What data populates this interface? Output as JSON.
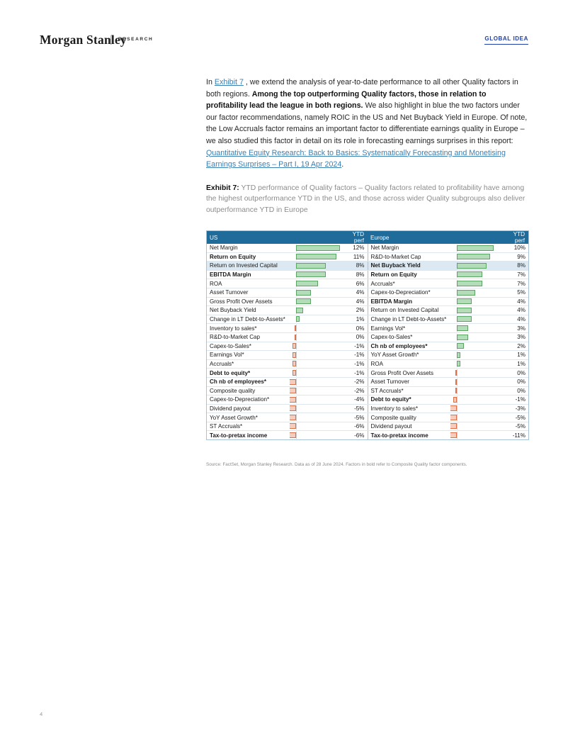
{
  "header": {
    "logo": "Morgan Stanley",
    "separator": "|",
    "research_label": "RESEARCH",
    "global_idea": "GLOBAL IDEA"
  },
  "body": {
    "para1_a": "In ",
    "para1_link1": "Exhibit 7",
    "para1_b": " , we extend the analysis of year-to-date performance to all other Quality factors in both regions. ",
    "para1_bold": "Among the top outperforming Quality factors, those in relation to profitability lead the league in both regions.",
    "para1_c": " We also highlight in blue the two factors under our factor recommendations, namely ROIC in the US and Net Buyback Yield in Europe. Of note, the Low Accruals factor remains an important factor to differentiate earnings quality in Europe – we also studied this factor in detail on its role in forecasting earnings surprises in this report: ",
    "para1_link2": "Quantitative Equity Research: Back to Basics: Systematically Forecasting and Monetising Earnings Surprises – Part I, 19 Apr 2024",
    "para1_d": "."
  },
  "exhibit": {
    "label": "Exhibit 7:",
    "caption": " YTD performance of Quality factors – Quality factors related to profitability have among the highest outperformance YTD in the US, and those across wider Quality subgroups also deliver outperformance YTD in Europe",
    "source": "Source: FactSet, Morgan Stanley Research. Data as of 28 June 2024. Factors in bold refer to Composite Quality factor components."
  },
  "table": {
    "headers": {
      "us": "US",
      "us_perf": "YTD perf",
      "europe": "Europe",
      "europe_perf": "YTD perf"
    },
    "us_rows": [
      {
        "name": "Net Margin",
        "value": "12%",
        "num": 12,
        "bold": false,
        "highlight": false
      },
      {
        "name": "Return on Equity",
        "value": "11%",
        "num": 11,
        "bold": true,
        "highlight": false
      },
      {
        "name": "Return on Invested Capital",
        "value": "8%",
        "num": 8,
        "bold": false,
        "highlight": true
      },
      {
        "name": "EBITDA Margin",
        "value": "8%",
        "num": 8,
        "bold": true,
        "highlight": false
      },
      {
        "name": "ROA",
        "value": "6%",
        "num": 6,
        "bold": false,
        "highlight": false
      },
      {
        "name": "Asset Turnover",
        "value": "4%",
        "num": 4,
        "bold": false,
        "highlight": false
      },
      {
        "name": "Gross Profit Over Assets",
        "value": "4%",
        "num": 4,
        "bold": false,
        "highlight": false
      },
      {
        "name": "Net Buyback Yield",
        "value": "2%",
        "num": 2,
        "bold": false,
        "highlight": false
      },
      {
        "name": "Change in LT Debt-to-Assets*",
        "value": "1%",
        "num": 1,
        "bold": false,
        "highlight": false
      },
      {
        "name": "Inventory to sales*",
        "value": "0%",
        "num": 0,
        "bold": false,
        "highlight": false
      },
      {
        "name": "R&D-to-Market Cap",
        "value": "0%",
        "num": 0,
        "bold": false,
        "highlight": false
      },
      {
        "name": "Capex-to-Sales*",
        "value": "-1%",
        "num": -1,
        "bold": false,
        "highlight": false
      },
      {
        "name": "Earnings Vol*",
        "value": "-1%",
        "num": -1,
        "bold": false,
        "highlight": false
      },
      {
        "name": "Accruals*",
        "value": "-1%",
        "num": -1,
        "bold": false,
        "highlight": false
      },
      {
        "name": "Debt to equity*",
        "value": "-1%",
        "num": -1,
        "bold": true,
        "highlight": false
      },
      {
        "name": "Ch nb of employees*",
        "value": "-2%",
        "num": -2,
        "bold": true,
        "highlight": false
      },
      {
        "name": "Composite quality",
        "value": "-2%",
        "num": -2,
        "bold": false,
        "highlight": false
      },
      {
        "name": "Capex-to-Depreciation*",
        "value": "-4%",
        "num": -4,
        "bold": false,
        "highlight": false
      },
      {
        "name": "Dividend payout",
        "value": "-5%",
        "num": -5,
        "bold": false,
        "highlight": false
      },
      {
        "name": "YoY Asset Growth*",
        "value": "-5%",
        "num": -5,
        "bold": false,
        "highlight": false
      },
      {
        "name": "ST Accruals*",
        "value": "-6%",
        "num": -6,
        "bold": false,
        "highlight": false
      },
      {
        "name": "Tax-to-pretax income",
        "value": "-6%",
        "num": -6,
        "bold": true,
        "highlight": false
      }
    ],
    "europe_rows": [
      {
        "name": "Net Margin",
        "value": "10%",
        "num": 10,
        "bold": false,
        "highlight": false
      },
      {
        "name": "R&D-to-Market Cap",
        "value": "9%",
        "num": 9,
        "bold": false,
        "highlight": false
      },
      {
        "name": "Net Buyback Yield",
        "value": "8%",
        "num": 8,
        "bold": true,
        "highlight": true
      },
      {
        "name": "Return on Equity",
        "value": "7%",
        "num": 7,
        "bold": true,
        "highlight": false
      },
      {
        "name": "Accruals*",
        "value": "7%",
        "num": 7,
        "bold": false,
        "highlight": false
      },
      {
        "name": "Capex-to-Depreciation*",
        "value": "5%",
        "num": 5,
        "bold": false,
        "highlight": false
      },
      {
        "name": "EBITDA Margin",
        "value": "4%",
        "num": 4,
        "bold": true,
        "highlight": false
      },
      {
        "name": "Return on Invested Capital",
        "value": "4%",
        "num": 4,
        "bold": false,
        "highlight": false
      },
      {
        "name": "Change in LT Debt-to-Assets*",
        "value": "4%",
        "num": 4,
        "bold": false,
        "highlight": false
      },
      {
        "name": "Earnings Vol*",
        "value": "3%",
        "num": 3,
        "bold": false,
        "highlight": false
      },
      {
        "name": "Capex-to-Sales*",
        "value": "3%",
        "num": 3,
        "bold": false,
        "highlight": false
      },
      {
        "name": "Ch nb of employees*",
        "value": "2%",
        "num": 2,
        "bold": true,
        "highlight": false
      },
      {
        "name": "YoY Asset Growth*",
        "value": "1%",
        "num": 1,
        "bold": false,
        "highlight": false
      },
      {
        "name": "ROA",
        "value": "1%",
        "num": 1,
        "bold": false,
        "highlight": false
      },
      {
        "name": "Gross Profit Over Assets",
        "value": "0%",
        "num": 0,
        "bold": false,
        "highlight": false
      },
      {
        "name": "Asset Turnover",
        "value": "0%",
        "num": 0,
        "bold": false,
        "highlight": false
      },
      {
        "name": "ST Accruals*",
        "value": "0%",
        "num": 0,
        "bold": false,
        "highlight": false
      },
      {
        "name": "Debt to equity*",
        "value": "-1%",
        "num": -1,
        "bold": true,
        "highlight": false
      },
      {
        "name": "Inventory to sales*",
        "value": "-3%",
        "num": -3,
        "bold": false,
        "highlight": false
      },
      {
        "name": "Composite quality",
        "value": "-5%",
        "num": -5,
        "bold": false,
        "highlight": false
      },
      {
        "name": "Dividend payout",
        "value": "-5%",
        "num": -5,
        "bold": false,
        "highlight": false
      },
      {
        "name": "Tax-to-pretax income",
        "value": "-11%",
        "num": -11,
        "bold": true,
        "highlight": false
      }
    ]
  },
  "footer": {
    "page_number": "4"
  },
  "colors": {
    "header_blue": "#1f6b9a",
    "highlight_blue": "#dce9f2",
    "positive_bar": "#b3dcb8",
    "positive_border": "#5ba463",
    "negative_bar": "#f6cdbc",
    "negative_border": "#d9714a",
    "link": "#3c7fb1",
    "global_idea": "#1f3fa8"
  }
}
